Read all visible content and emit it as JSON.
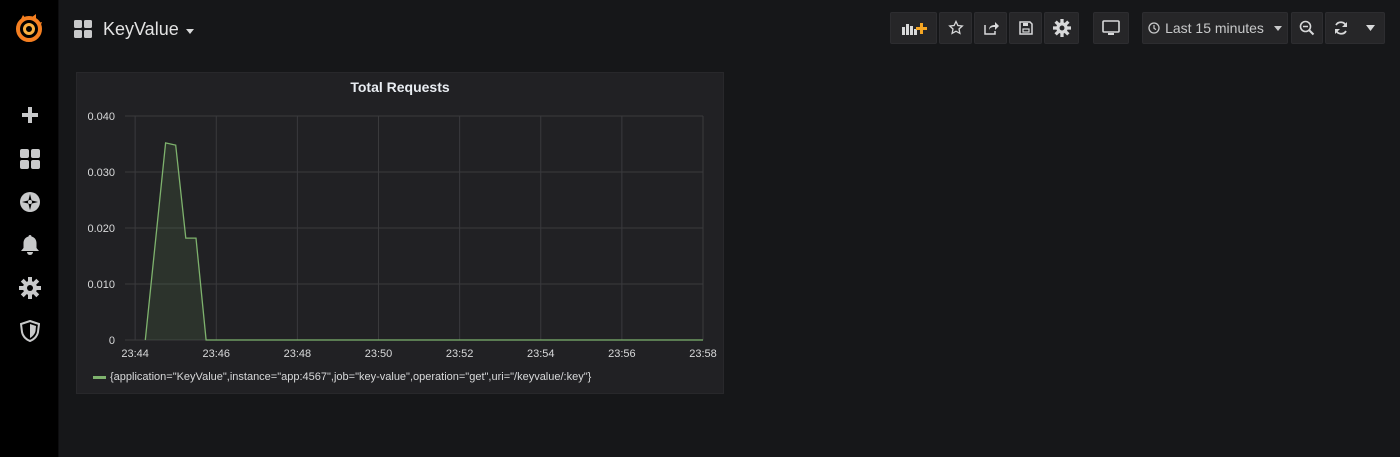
{
  "dashboard": {
    "title": "KeyValue"
  },
  "sidebar": {
    "items": [
      {
        "name": "plus-icon"
      },
      {
        "name": "dashboards-icon"
      },
      {
        "name": "explore-icon"
      },
      {
        "name": "bell-icon"
      },
      {
        "name": "gear-icon"
      },
      {
        "name": "shield-icon"
      }
    ]
  },
  "toolbar": {
    "time_range": "Last 15 minutes"
  },
  "colors": {
    "series": "#7eb26d",
    "logo": "#f57f21",
    "background": "#161719",
    "panel": "#212124"
  },
  "panel": {
    "title": "Total Requests",
    "legend": "{application=\"KeyValue\",instance=\"app:4567\",job=\"key-value\",operation=\"get\",uri=\"/keyvalue/:key\"}"
  },
  "chart_data": {
    "type": "area",
    "title": "Total Requests",
    "xlabel": "",
    "ylabel": "",
    "x_ticks": [
      "23:44",
      "23:46",
      "23:48",
      "23:50",
      "23:52",
      "23:54",
      "23:56",
      "23:58"
    ],
    "y_ticks": [
      "0",
      "0.010",
      "0.020",
      "0.030",
      "0.040"
    ],
    "xlim": [
      "23:43:45",
      "23:58:00"
    ],
    "ylim": [
      0,
      0.04
    ],
    "grid": true,
    "legend_position": "bottom",
    "series": [
      {
        "name": "{application=\"KeyValue\",instance=\"app:4567\",job=\"key-value\",operation=\"get\",uri=\"/keyvalue/:key\"}",
        "points": [
          [
            "23:44:15",
            0
          ],
          [
            "23:44:45",
            0.0352
          ],
          [
            "23:45:00",
            0.0348
          ],
          [
            "23:45:15",
            0.0182
          ],
          [
            "23:45:30",
            0.0182
          ],
          [
            "23:45:45",
            0
          ],
          [
            "23:58:00",
            0
          ]
        ]
      }
    ]
  }
}
